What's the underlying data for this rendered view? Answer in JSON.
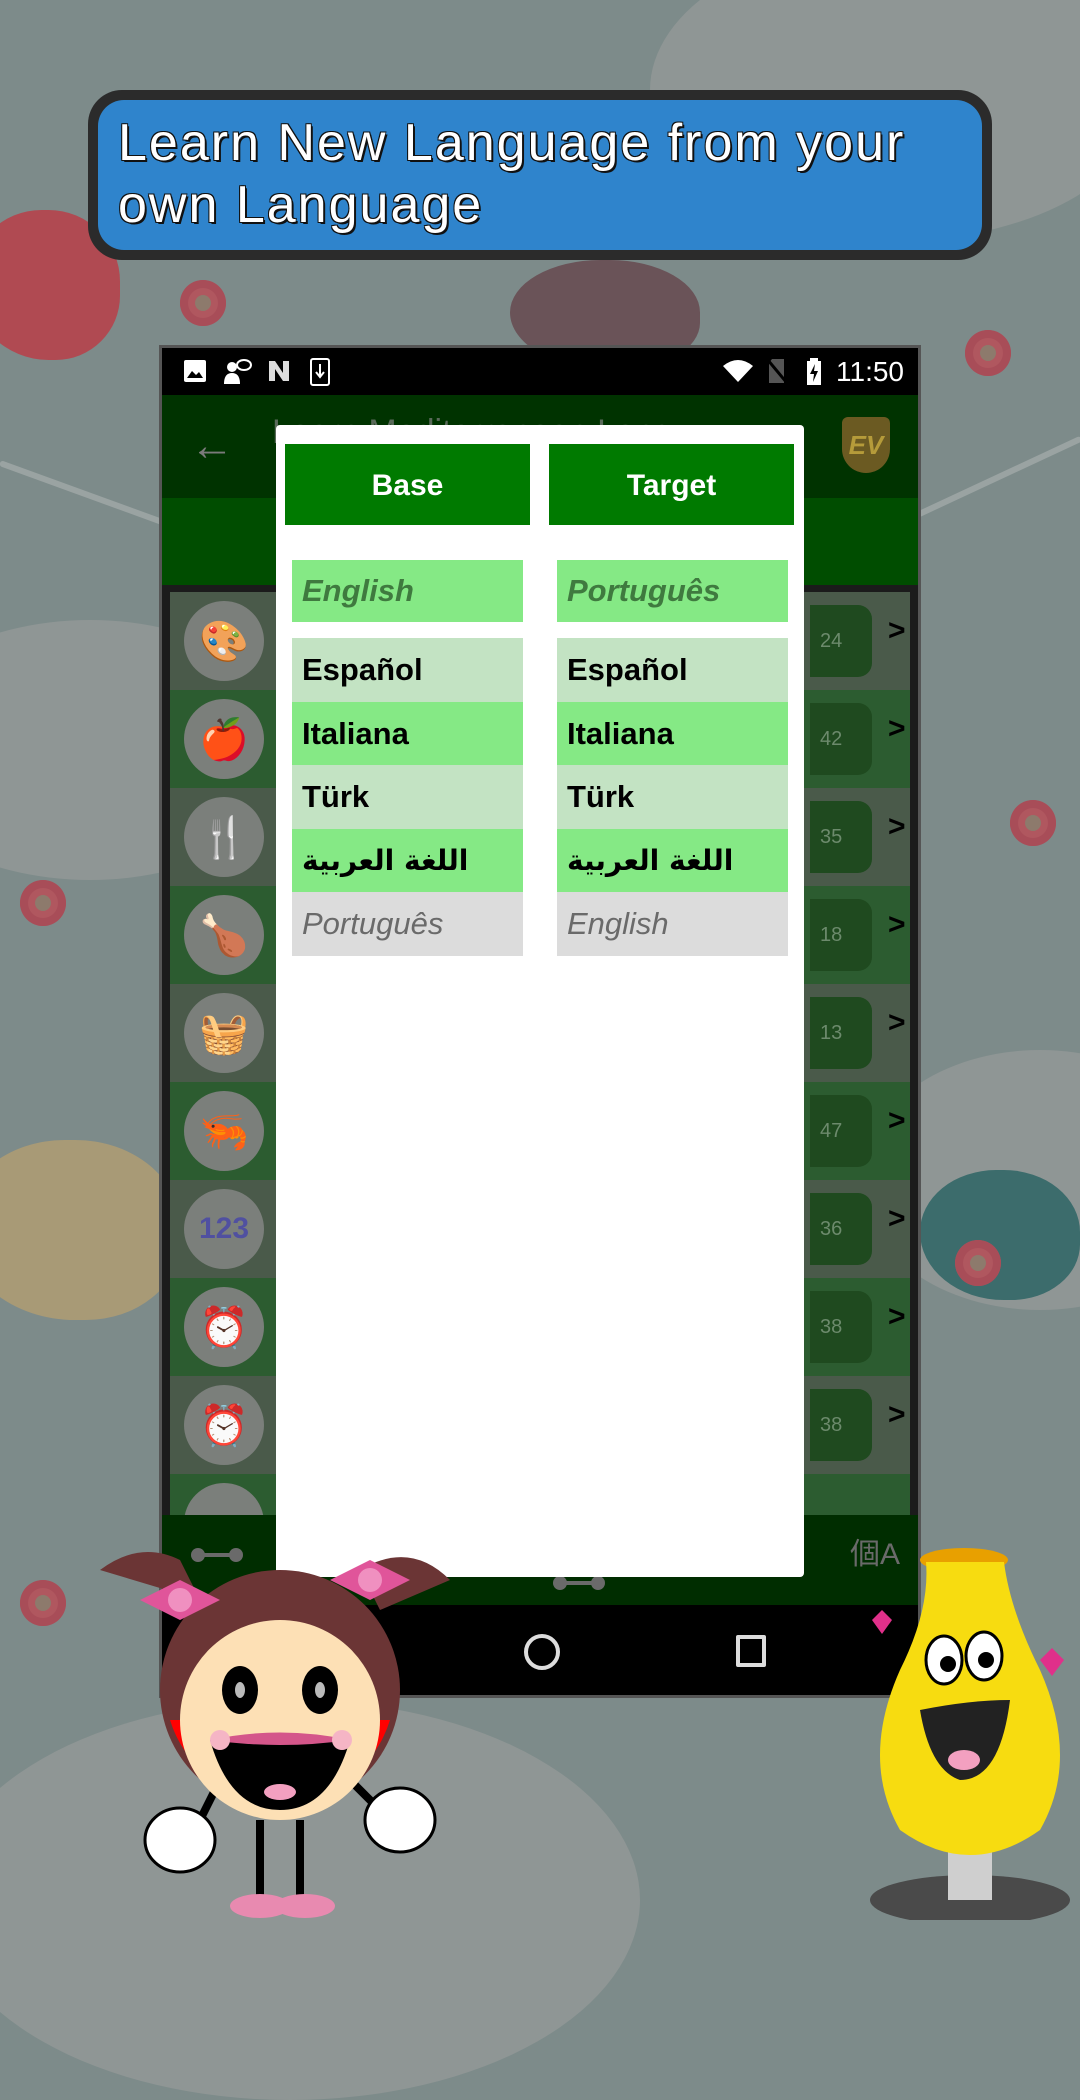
{
  "banner": {
    "text": "Learn New Language from your own Language"
  },
  "phone": {
    "status_bar": {
      "left_icons": [
        "image-icon",
        "chat-icon",
        "n-icon",
        "download-icon"
      ],
      "right_icons": [
        "wifi-icon",
        "no-sim-icon",
        "battery-charging-icon"
      ],
      "time": "11:50"
    },
    "app_bar": {
      "back_icon": "arrow-left-icon",
      "title": "Learn Mediterranean Lang...",
      "logo": "EV"
    },
    "list": {
      "rows": [
        {
          "icon": "paint-icon",
          "glyph": "🎨",
          "count": "24"
        },
        {
          "icon": "apple-icon",
          "glyph": "🍎",
          "count": "42"
        },
        {
          "icon": "cutlery-icon",
          "glyph": "🍴",
          "count": "35"
        },
        {
          "icon": "roast-chicken-icon",
          "glyph": "🍗",
          "count": "18"
        },
        {
          "icon": "vegetable-basket-icon",
          "glyph": "🧺",
          "count": "13"
        },
        {
          "icon": "seafood-icon",
          "glyph": "🦐",
          "count": "47"
        },
        {
          "icon": "numbers-icon",
          "glyph": "123",
          "count": "36"
        },
        {
          "icon": "alarm-clock-icon",
          "glyph": "⏰",
          "count": "38"
        },
        {
          "icon": "alarm-clock-icon",
          "glyph": "⏰",
          "count": "38"
        },
        {
          "icon": "partial-icon",
          "glyph": "",
          "count": ""
        }
      ],
      "arrow": ">"
    },
    "bottom_bar": {
      "icons": [
        "connector-icon",
        "translate-icon"
      ],
      "translate_glyph": "個A"
    }
  },
  "dialog": {
    "tabs": {
      "base": "Base",
      "target": "Target"
    },
    "base": {
      "selected": "English",
      "items": [
        {
          "label": "Español",
          "style": "light"
        },
        {
          "label": "Italiana",
          "style": "bright"
        },
        {
          "label": "Türk",
          "style": "light"
        },
        {
          "label": "اللغة العربية",
          "style": "bright"
        },
        {
          "label": "Português",
          "style": "disabled"
        }
      ]
    },
    "target": {
      "selected": "Português",
      "items": [
        {
          "label": "Español",
          "style": "light"
        },
        {
          "label": "Italiana",
          "style": "bright"
        },
        {
          "label": "Türk",
          "style": "light"
        },
        {
          "label": "اللغة العربية",
          "style": "bright"
        },
        {
          "label": "English",
          "style": "disabled"
        }
      ]
    }
  },
  "colors": {
    "banner_blue": "#2f84cc",
    "tab_green": "#007a00",
    "selected_green": "#85e985",
    "light_green": "#c3e3c3",
    "disabled_gray": "#dcdcdc"
  }
}
